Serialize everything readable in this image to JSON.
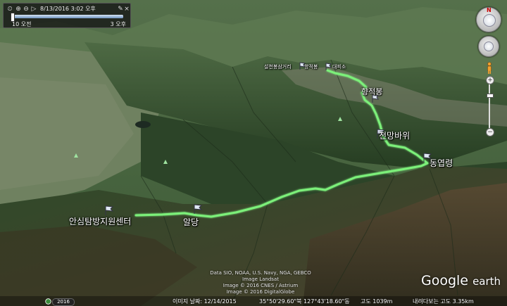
{
  "timebar": {
    "date_time": "8/13/2016   3:02 오후",
    "start_label": "10 오전",
    "end_label": "3 오후"
  },
  "labels": {
    "visitor_center": "안심탐방지원센터",
    "aldang": "알당",
    "dongyeopryeong": "동엽령",
    "jeonmangbawi": "전망바위",
    "summit_label": "향적봉",
    "ridge_labels": [
      "설천봉삼거리",
      "향적봉",
      "대피소"
    ]
  },
  "attribution": {
    "line1": "Data SIO, NOAA, U.S. Navy, NGA, GEBCO",
    "line2": "Image Landsat",
    "line3": "Image © 2016 CNES / Astrium",
    "line4": "Image © 2016 DigitalGlobe"
  },
  "logo": {
    "google": "Google",
    "earth": "earth"
  },
  "status": {
    "year": "2016",
    "image_date": "이미지 날짜: 12/14/2015",
    "coords": "35°50'29.60\"북 127°43'18.60\"동",
    "elevation": "고도 1039m",
    "eye_alt": "내려다보는 고도 3.35km"
  },
  "colors": {
    "track": "#7cf07a",
    "track_glow": "#c8ffc0"
  }
}
